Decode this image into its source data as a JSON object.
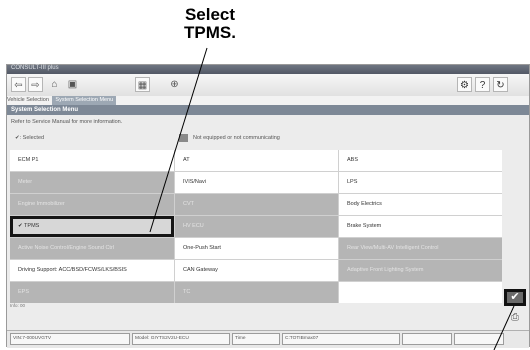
{
  "callout": {
    "line1": "Select",
    "line2": "TPMS."
  },
  "window": {
    "title": "CONSULT-III plus"
  },
  "toolbar": {
    "back_icon": "⇦",
    "forward_icon": "⇨",
    "home_icon": "⌂",
    "screen_icon": "▣",
    "zoom_icon": "⊕",
    "capture_icon": "▦",
    "settings_label": "⚙",
    "help_label": "?",
    "refresh_label": "↻"
  },
  "breadcrumb": {
    "prev": "Vehicle Selection",
    "current": "System Selection Menu"
  },
  "panel": {
    "header": "System Selection Menu",
    "note": "Refer to Service Manual for more information.",
    "legend_selected": "✔: Selected",
    "legend_unequipped": "Not equipped or not communicating"
  },
  "systems": {
    "r0c0": "ECM P1",
    "r0c1": "AT",
    "r0c2": "ABS",
    "r1c0": "Meter",
    "r1c1": "IVIS/Navi",
    "r1c2": "LPS",
    "r2c0": "Engine Immobilizer",
    "r2c1": "CVT",
    "r2c2": "Body Electrics",
    "r3c0": "✔ TPMS",
    "r3c1": "HV ECU",
    "r3c2": "Brake System",
    "r4c0": "Active Noise Control/Engine Sound Ctrl",
    "r4c1": "One-Push Start",
    "r4c2": "Rear View/Multi-AV Intelligent Control",
    "r5c0": "Driving Support: ACC/BSD/FCWS/LKS/BSIS",
    "r5c1": "CAN Gateway",
    "r5c2": "Adaptive Front Lighting System",
    "r6c0": "EPS",
    "r6c1": "TC",
    "r6c2": ""
  },
  "sidebar": {
    "confirm_icon": "✔",
    "print_icon": "⎙"
  },
  "grid_footer": "Info: 00",
  "statusbar": {
    "vin": "VIN:7-000UVGTV",
    "model": "Model: GIYTS2V2U-ECU",
    "engine": "Time",
    "extra": "C:TOTIBmax07",
    "blank1": "",
    "blank2": ""
  }
}
